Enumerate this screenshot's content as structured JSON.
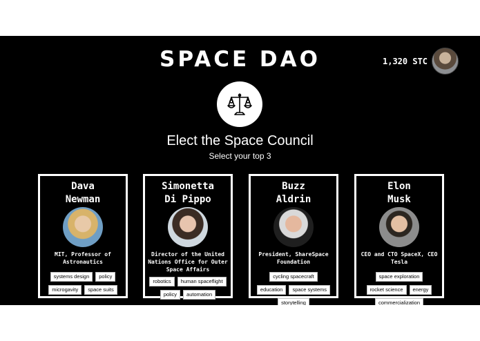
{
  "app": {
    "logo_text": "SPACE DAO"
  },
  "header": {
    "balance": "1,320 STC"
  },
  "main": {
    "emblem_icon": "scales-of-justice-icon",
    "title": "Elect the Space Council",
    "subtitle": "Select your top 3"
  },
  "candidates": [
    {
      "name_line1": "Dava",
      "name_line2": "Newman",
      "title": "MIT, Professor of Astronautics",
      "tags": [
        "systems design",
        "policy",
        "microgavity",
        "space suits"
      ]
    },
    {
      "name_line1": "Simonetta",
      "name_line2": "Di Pippo",
      "title": "Director of the United Nations Office for Outer Space Affairs",
      "tags": [
        "robotics",
        "human spaceflight",
        "policy",
        "automation"
      ]
    },
    {
      "name_line1": "Buzz",
      "name_line2": "Aldrin",
      "title": "President, ShareSpace Foundation",
      "tags": [
        "cycling spacecraft",
        "education",
        "space systems",
        "storytelling"
      ]
    },
    {
      "name_line1": "Elon",
      "name_line2": "Musk",
      "title": "CEO and CTO SpaceX, CEO Tesla",
      "tags": [
        "space exploration",
        "rocket science",
        "energy",
        "commercialization"
      ]
    }
  ],
  "colors": {
    "background": "#000000",
    "foreground": "#ffffff"
  }
}
